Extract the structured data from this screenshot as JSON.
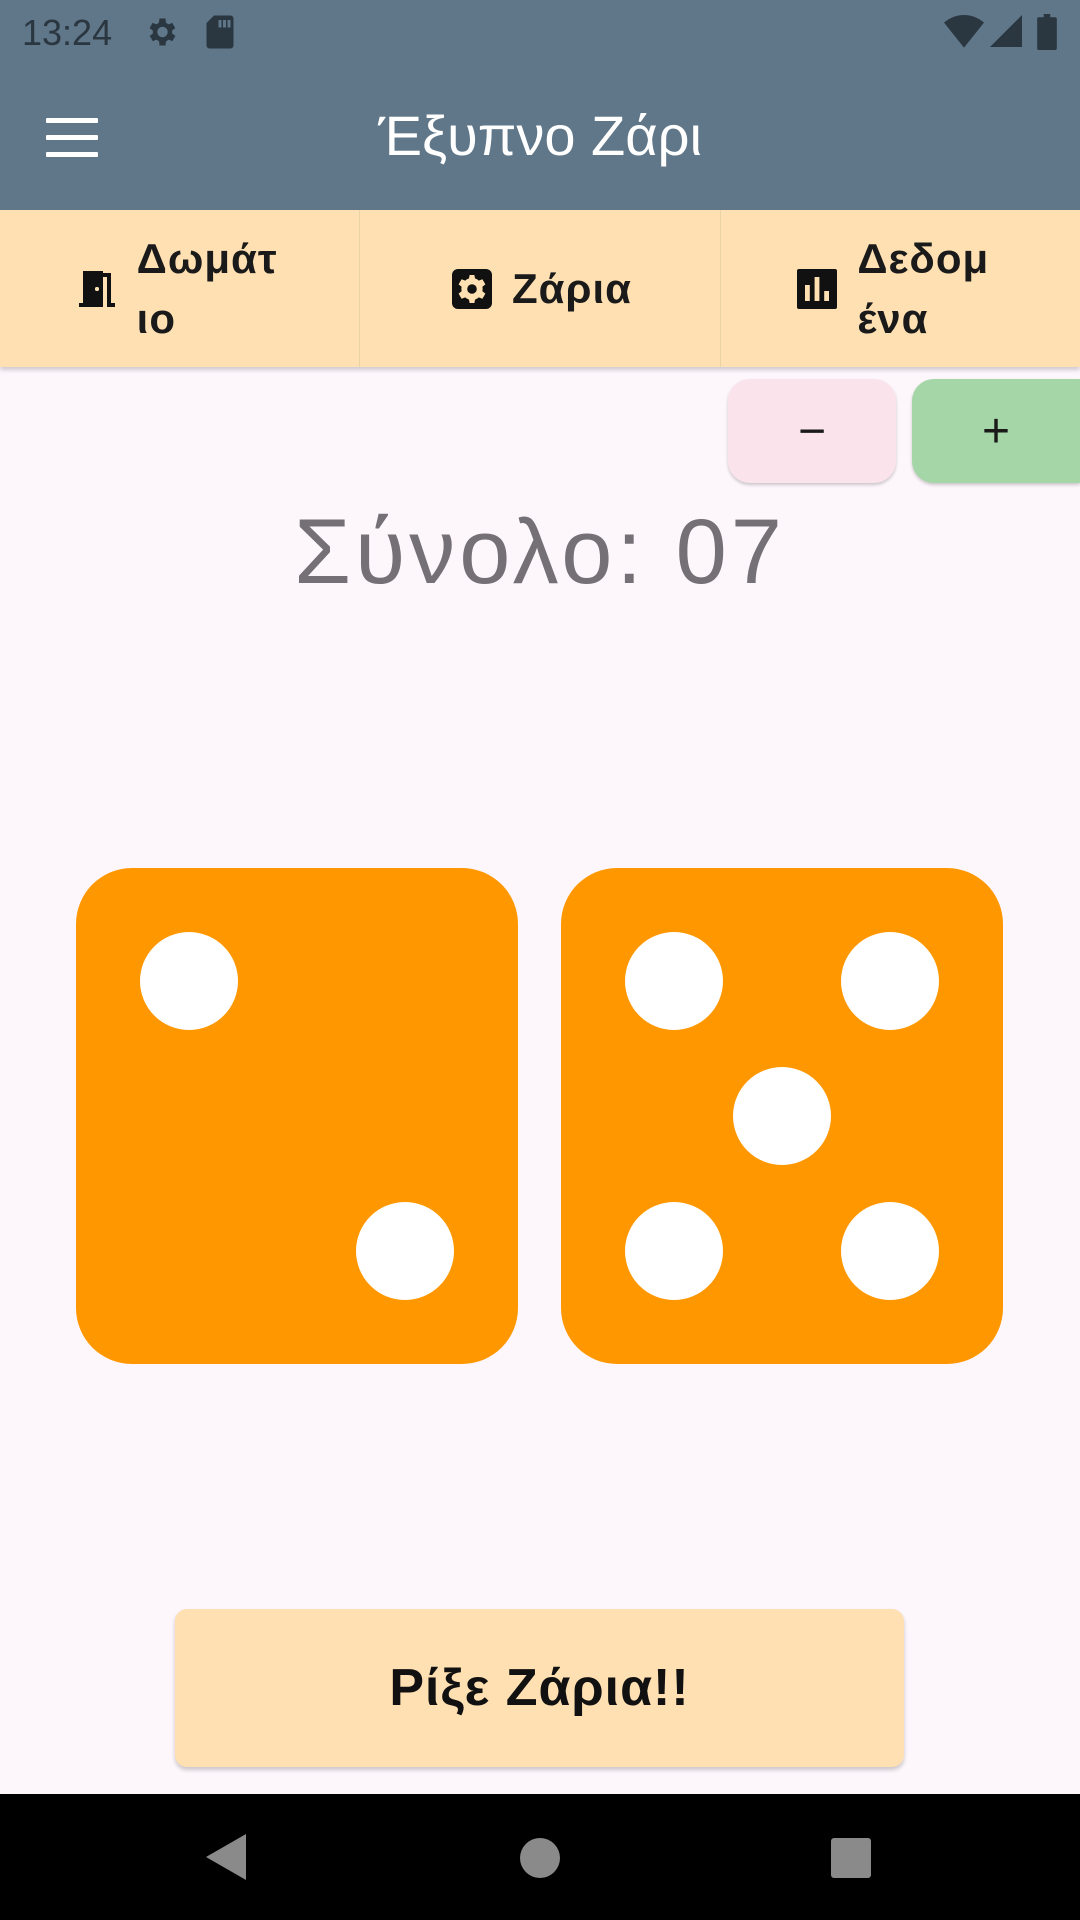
{
  "status_bar": {
    "time": "13:24",
    "icons": [
      "settings-gear-icon",
      "sd-card-icon",
      "wifi-icon",
      "cell-signal-icon",
      "battery-icon"
    ]
  },
  "app_bar": {
    "title": "Έξυπνο Ζάρι",
    "menu_icon": "hamburger-menu-icon"
  },
  "tabs": [
    {
      "label": "Δωμάτιο",
      "icon": "door-icon"
    },
    {
      "label": "Ζάρια",
      "icon": "dice-icon"
    },
    {
      "label": "Δεδομένα",
      "icon": "bar-chart-icon"
    }
  ],
  "dice_controls": {
    "minus_label": "−",
    "plus_label": "+"
  },
  "total": {
    "text": "Σύνολο: 07",
    "value": 7
  },
  "dice": [
    {
      "value": 2,
      "color": "#ff9800"
    },
    {
      "value": 5,
      "color": "#ff9800"
    }
  ],
  "roll_button": {
    "label": "Ρίξε Ζάρια!!"
  },
  "colors": {
    "app_bar": "#607789",
    "tab_bar": "#fee0b2",
    "die": "#ff9800",
    "plus_button": "#a5d6a7",
    "minus_button": "#fae3ea",
    "background": "#fdf7fc"
  }
}
